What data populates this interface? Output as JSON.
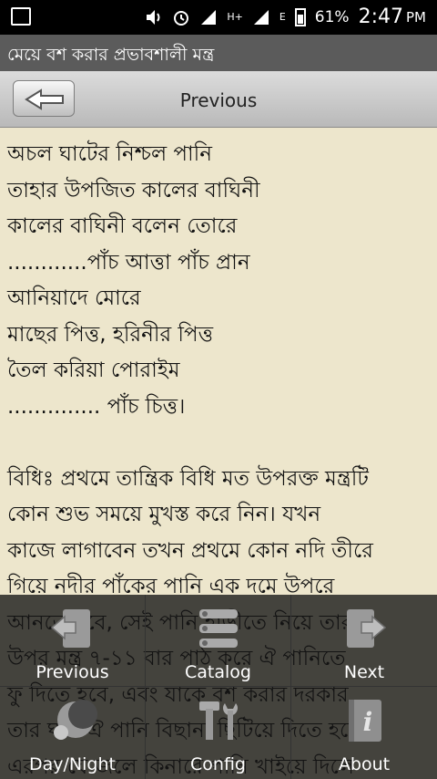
{
  "status": {
    "battery": "61%",
    "time": "2:47",
    "ampm": "PM",
    "network_a": "H+",
    "network_b": "E"
  },
  "app_title": "মেয়ে বশ করার প্রভাবশালী মন্ত্র",
  "nav": {
    "title": "Previous"
  },
  "content_lines": [
    " অচল ঘাটের নিশ্চল পানি",
    "তাহার উপজিত কালের বাঘিনী",
    "কালের বাঘিনী বলেন তোরে",
    "............পাঁচ আত্তা পাঁচ প্রান",
    "আনিয়াদে মোরে",
    "মাছের পিত্ত, হরিনীর পিত্ত",
    "তৈল করিয়া পোরাইম",
    ".............. পাঁচ চিত্ত।",
    "",
    "বিধিঃ প্রথমে তান্ত্রিক বিধি মত উপরক্ত মন্ত্রটি",
    "কোন শুভ সময়ে মুখস্ত করে নিন। যখন",
    "কাজে লাগাবেন তখন প্রথমে কোন নদি তীরে",
    "গিয়ে নদীর পাঁকের পানি এক দমে উপরে",
    "আনতে হবে, সেই পানি হাড়ীতে নিয়ে তার",
    "উপর মন্ত্র ৭-১১ বার পাঠ করে ঐ পানিতে",
    "ফু দিতে হবে, এবং যাকে বশ করার দরকার",
    "তার ঘরে ঐ পানি বিছানা ছিটিয়ে দিতে হবে।",
    "এরপর যে জলে কিনারে পানি খাইয়ে দিলে"
  ],
  "menu": [
    {
      "label": "Previous",
      "icon": "previous-page-icon"
    },
    {
      "label": "Catalog",
      "icon": "catalog-icon"
    },
    {
      "label": "Next",
      "icon": "next-page-icon"
    },
    {
      "label": "Day/Night",
      "icon": "day-night-icon"
    },
    {
      "label": "Config",
      "icon": "config-tools-icon"
    },
    {
      "label": "About",
      "icon": "about-book-icon"
    }
  ]
}
